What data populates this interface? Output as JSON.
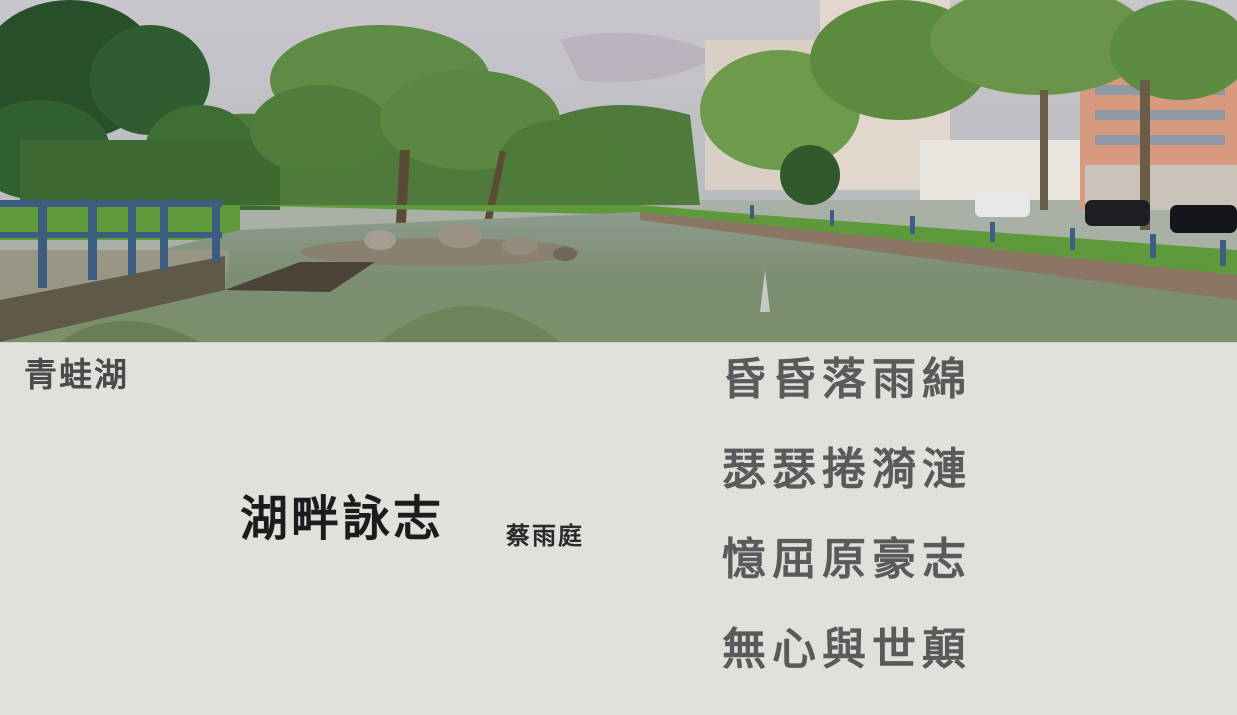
{
  "place_label": "青蛙湖",
  "poem": {
    "title": "湖畔詠志",
    "author": "蔡雨庭",
    "lines": [
      "昏昏落雨綿",
      "瑟瑟捲漪漣",
      "憶屈原豪志",
      "無心與世顛"
    ]
  },
  "colors": {
    "panel_background": "#dee2da",
    "title_text": "#1c1c1c",
    "verse_text": "#5a5a5a",
    "label_text": "#4a4a4a"
  }
}
